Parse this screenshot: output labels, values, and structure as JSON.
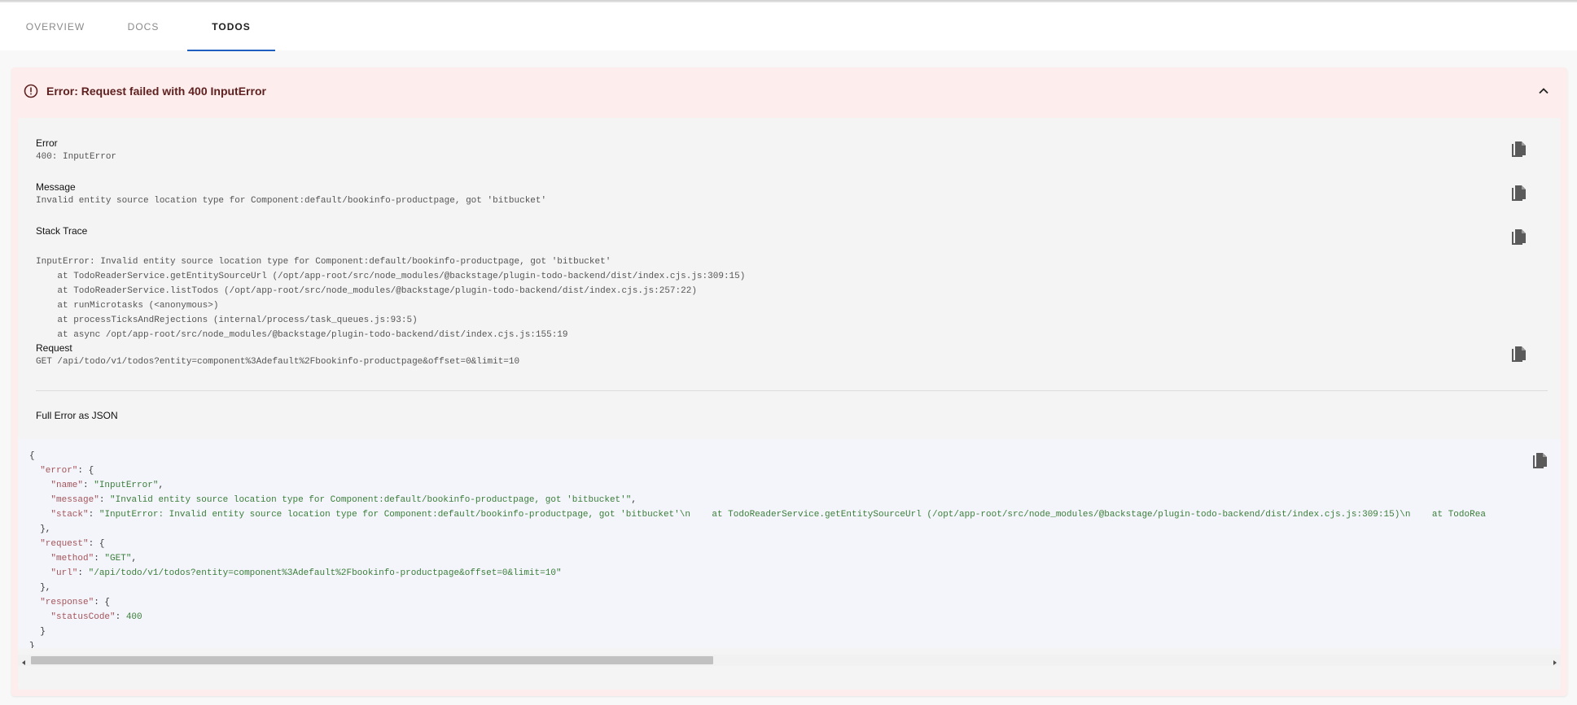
{
  "tabs": [
    {
      "label": "OVERVIEW"
    },
    {
      "label": "DOCS"
    },
    {
      "label": "TODOS"
    }
  ],
  "alert": {
    "title": "Error: Request failed with 400 InputError",
    "icon": "error-outline-icon",
    "collapse_icon": "chevron-up-icon"
  },
  "sections": {
    "error": {
      "label": "Error",
      "value": "400: InputError"
    },
    "message": {
      "label": "Message",
      "value": "Invalid entity source location type for Component:default/bookinfo-productpage, got 'bitbucket'"
    },
    "stack": {
      "label": "Stack Trace",
      "lines": [
        "InputError: Invalid entity source location type for Component:default/bookinfo-productpage, got 'bitbucket'",
        "    at TodoReaderService.getEntitySourceUrl (/opt/app-root/src/node_modules/@backstage/plugin-todo-backend/dist/index.cjs.js:309:15)",
        "    at TodoReaderService.listTodos (/opt/app-root/src/node_modules/@backstage/plugin-todo-backend/dist/index.cjs.js:257:22)",
        "    at runMicrotasks (<anonymous>)",
        "    at processTicksAndRejections (internal/process/task_queues.js:93:5)",
        "    at async /opt/app-root/src/node_modules/@backstage/plugin-todo-backend/dist/index.cjs.js:155:19"
      ]
    },
    "request": {
      "label": "Request",
      "value": "GET /api/todo/v1/todos?entity=component%3Adefault%2Fbookinfo-productpage&offset=0&limit=10"
    },
    "json_label": "Full Error as JSON"
  },
  "json": {
    "error_name": "InputError",
    "error_message": "Invalid entity source location type for Component:default/bookinfo-productpage, got 'bitbucket'",
    "error_stack": "InputError: Invalid entity source location type for Component:default/bookinfo-productpage, got 'bitbucket'\\n    at TodoReaderService.getEntitySourceUrl (/opt/app-root/src/node_modules/@backstage/plugin-todo-backend/dist/index.cjs.js:309:15)\\n    at TodoRea",
    "request_method": "GET",
    "request_url": "/api/todo/v1/todos?entity=component%3Adefault%2Fbookinfo-productpage&offset=0&limit=10",
    "response_statusCode": "400"
  },
  "scrollbar": {
    "position_fraction": 0,
    "visible_fraction": 0.45
  },
  "colors": {
    "tab_indicator": "#1f5fbf",
    "alert_bg": "#fdeded",
    "alert_title": "#5f2120",
    "json_key": "#a3545a",
    "json_string": "#3a7d3a"
  }
}
